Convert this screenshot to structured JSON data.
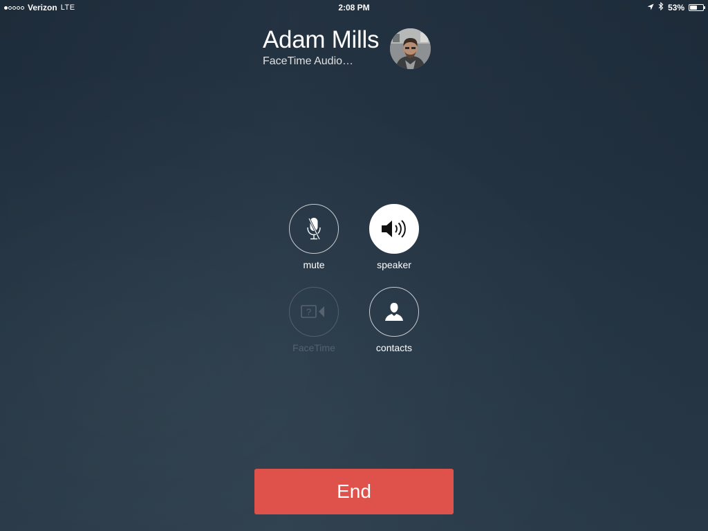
{
  "status_bar": {
    "carrier": "Verizon",
    "network": "LTE",
    "signal_bars_filled": 1,
    "signal_bars_total": 5,
    "time": "2:08 PM",
    "battery_percent": "53%",
    "battery_level": 0.53,
    "icons": [
      "location-arrow-icon",
      "bluetooth-icon",
      "battery-icon"
    ]
  },
  "call": {
    "caller_name": "Adam Mills",
    "status": "FaceTime Audio…"
  },
  "controls": [
    {
      "id": "mute",
      "label": "mute",
      "icon": "microphone-muted-icon",
      "state": "off"
    },
    {
      "id": "speaker",
      "label": "speaker",
      "icon": "speaker-icon",
      "state": "active"
    },
    {
      "id": "facetime",
      "label": "FaceTime",
      "icon": "facetime-video-icon",
      "state": "disabled"
    },
    {
      "id": "contacts",
      "label": "contacts",
      "icon": "contact-person-icon",
      "state": "off"
    }
  ],
  "end_button": {
    "label": "End"
  },
  "colors": {
    "end_button": "#df524b",
    "background_top": "#1f2e3d",
    "background_bottom": "#2a3b4a",
    "active_control": "#ffffff"
  }
}
